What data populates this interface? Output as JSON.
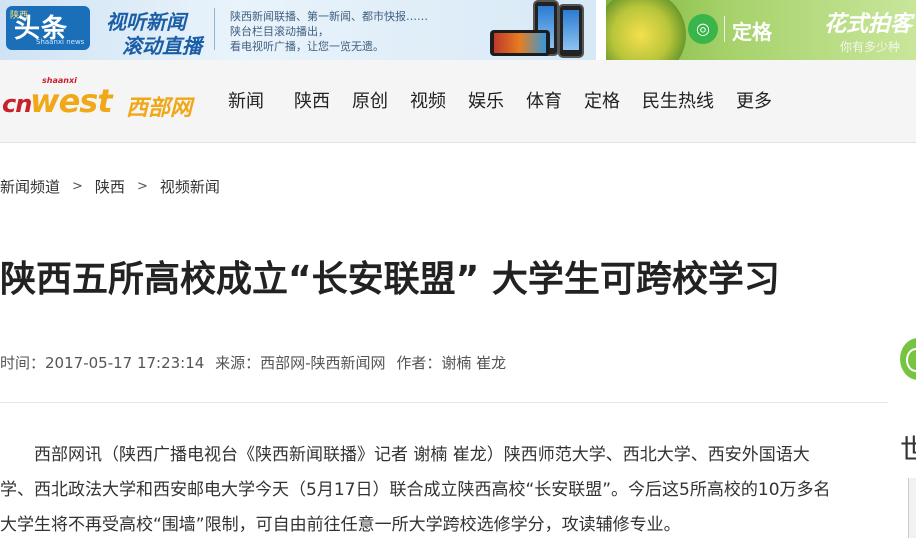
{
  "banner_left": {
    "badge_small": "陕西",
    "badge_main": "头条",
    "badge_en": "Shaanxi news",
    "slogan_line1": "视听新闻",
    "slogan_line2": "滚动直播",
    "desc_line1": "陕西新闻联播、第一新闻、都市快报……",
    "desc_line2": "陕台栏目滚动播出，",
    "desc_line3": "看电视听广播，让您一览无遗。"
  },
  "banner_right": {
    "brand": "定格",
    "slogan": "花式拍客",
    "sub": "你有多少种"
  },
  "logo": {
    "shaanxi": "shaanxi",
    "cn": "cn",
    "west": "west",
    "cn_name": "西部网"
  },
  "nav": {
    "items": [
      "新闻",
      "陕西",
      "原创",
      "视频",
      "娱乐",
      "体育",
      "定格",
      "民生热线",
      "更多"
    ]
  },
  "breadcrumb": {
    "items": [
      "新闻频道",
      "陕西",
      "视频新闻"
    ],
    "separator": ">"
  },
  "article": {
    "title": "陕西五所高校成立“长安联盟” 大学生可跨校学习",
    "time_label": "时间：",
    "time": "2017-05-17 17:23:14",
    "source_label": "来源：",
    "source": "西部网-陕西新闻网",
    "author_label": "作者：",
    "author": "谢楠 崔龙",
    "paragraph1": "西部网讯（陕西广播电视台《陕西新闻联播》记者 谢楠 崔龙）陕西师范大学、西北大学、西安外国语大学、西北政法大学和西安邮电大学今天（5月17日）联合成立陕西高校“长安联盟”。今后这5所高校的10万多名大学生将不再受高校“围墙”限制，可自由前往任意一所大学跨校选修学分，攻读辅修专业。"
  },
  "sidebar": {
    "partial_char": "世"
  }
}
